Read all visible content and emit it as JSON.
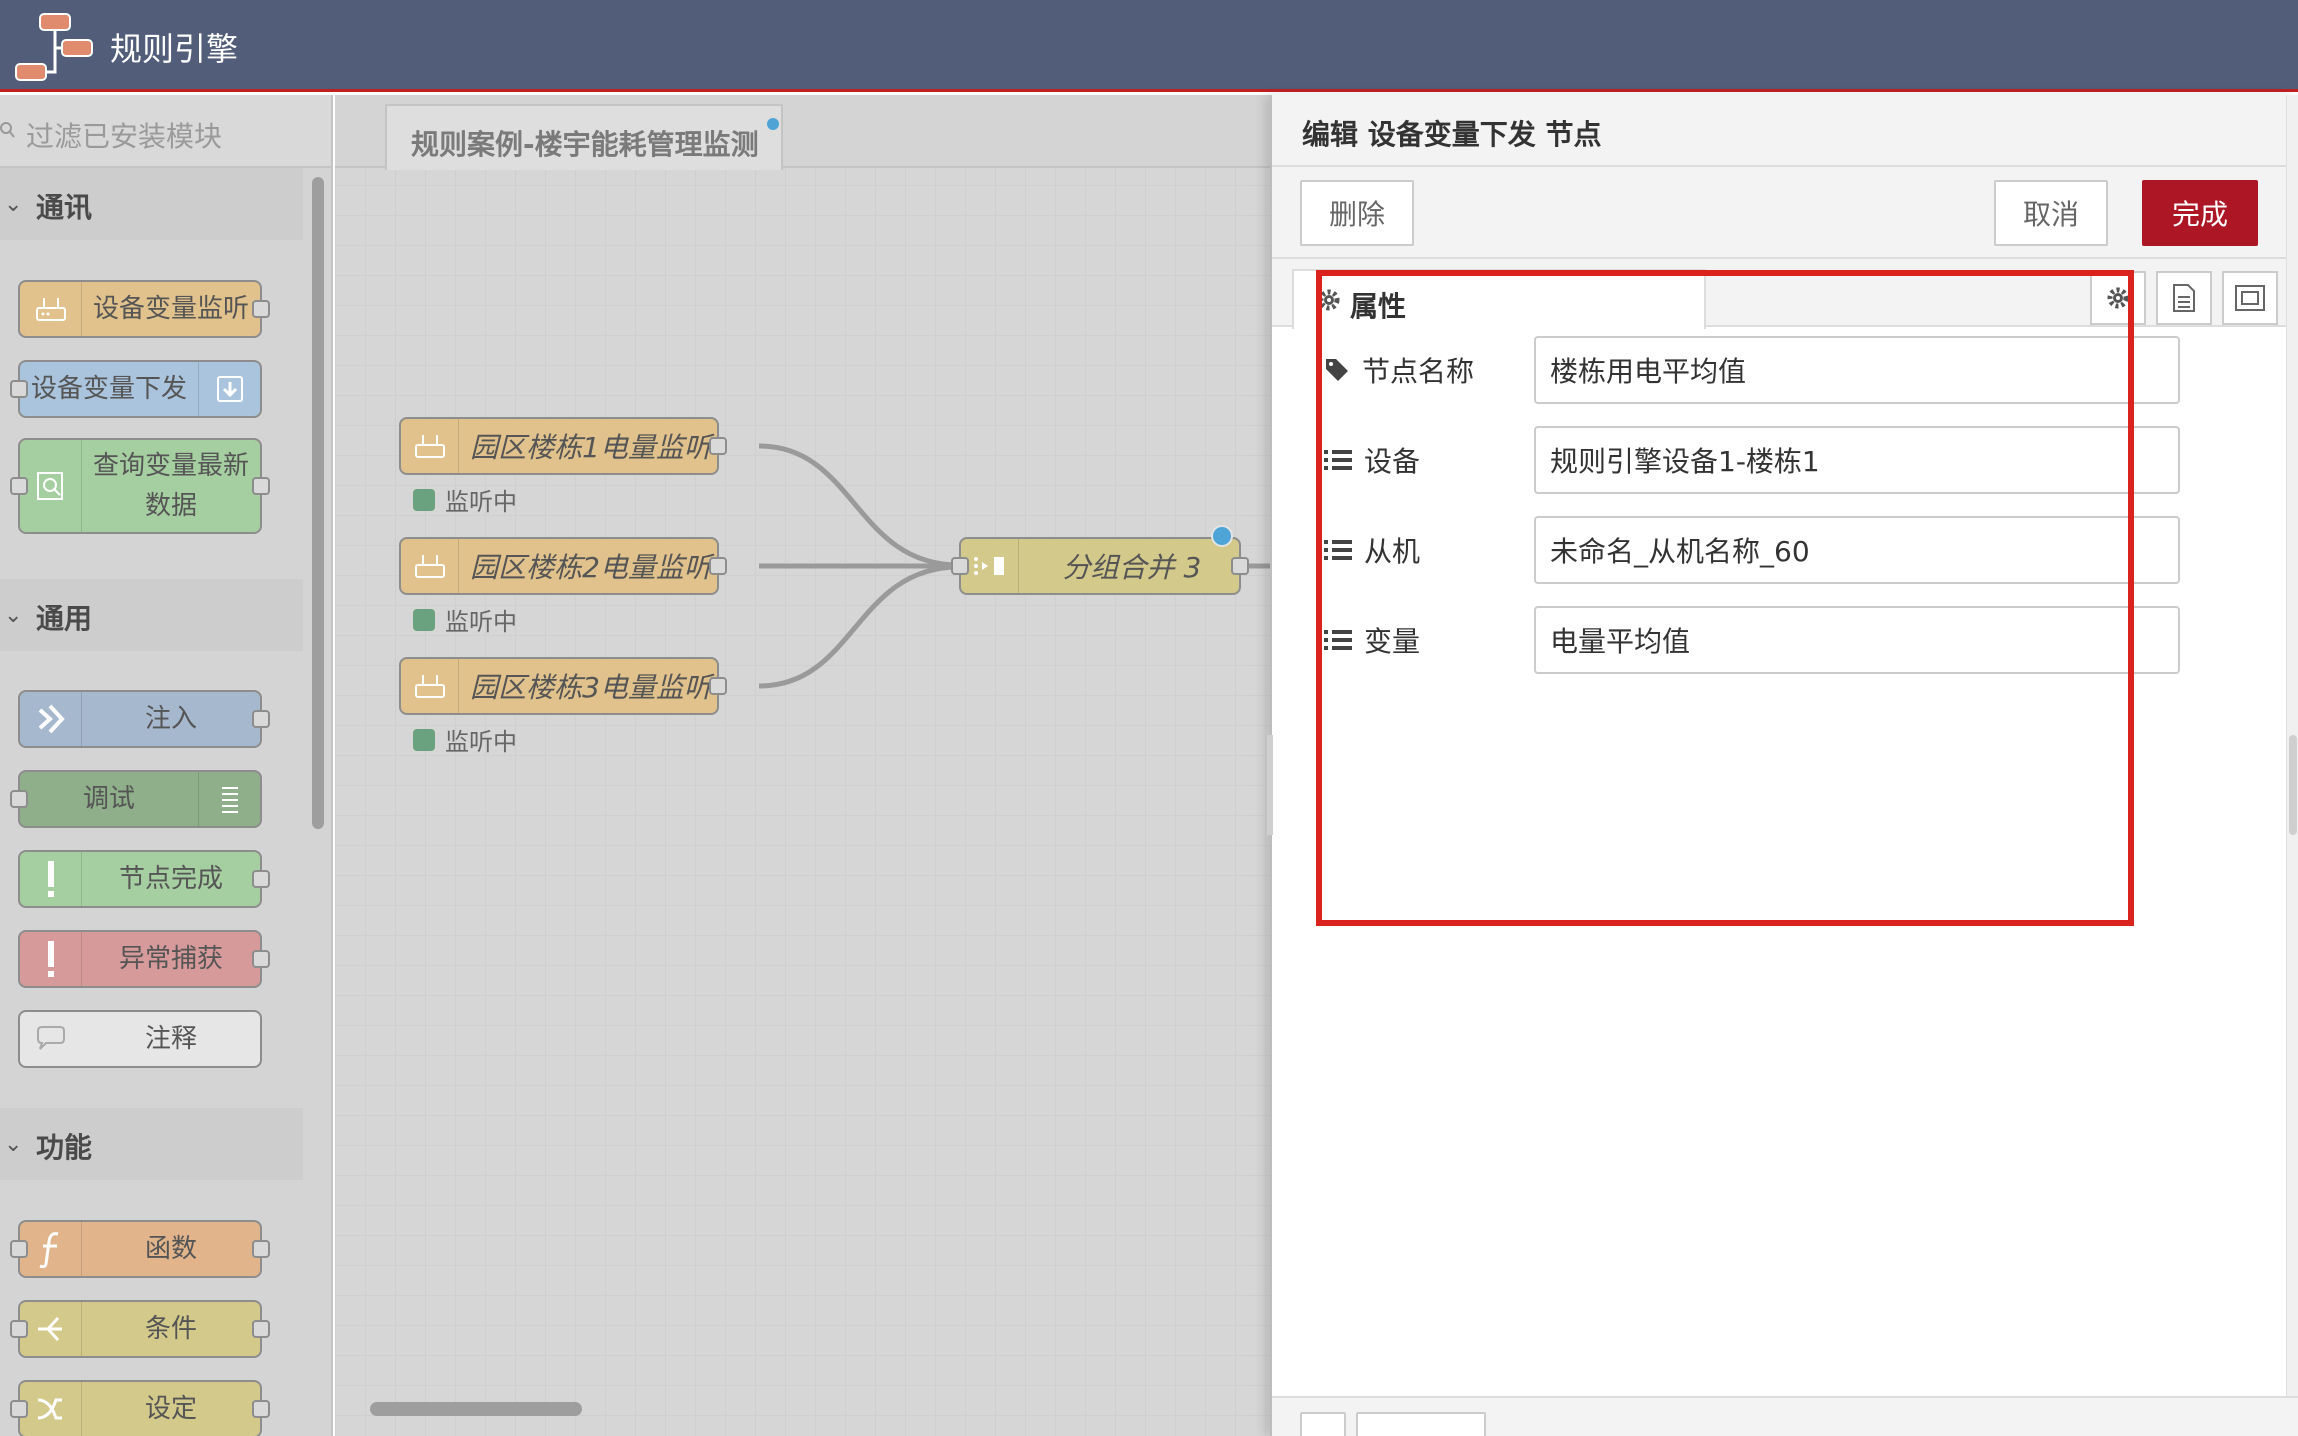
{
  "header": {
    "title": "规则引擎"
  },
  "palette": {
    "search_placeholder": "过滤已安装模块",
    "categories": [
      {
        "label": "通讯"
      },
      {
        "label": "通用"
      },
      {
        "label": "功能"
      }
    ],
    "nodes": {
      "device_listen": "设备变量监听",
      "device_send": "设备变量下发",
      "query_latest_1": "查询变量最新",
      "query_latest_2": "数据",
      "inject": "注入",
      "debug": "调试",
      "complete": "节点完成",
      "catch": "异常捕获",
      "comment": "注释",
      "function": "函数",
      "switch": "条件",
      "change": "设定"
    }
  },
  "workspace": {
    "tab_label": "规则案例-楼宇能耗管理监测",
    "nodes": {
      "listen1": "园区楼栋1电量监听",
      "listen2": "园区楼栋2电量监听",
      "listen3": "园区楼栋3电量监听",
      "join": "分组合并 3"
    },
    "status_text": "监听中"
  },
  "tray": {
    "title": "编辑 设备变量下发 节点",
    "delete_label": "删除",
    "cancel_label": "取消",
    "done_label": "完成",
    "tab_properties": "属性",
    "fields": {
      "name_label": "节点名称",
      "name_value": "楼栋用电平均值",
      "device_label": "设备",
      "device_value": "规则引擎设备1-楼栋1",
      "slave_label": "从机",
      "slave_value": "未命名_从机名称_60",
      "variable_label": "变量",
      "variable_value": "电量平均值"
    }
  },
  "colors": {
    "header_bg": "#525d7a",
    "primary_button": "#ad1625",
    "highlight": "#d9231c"
  }
}
